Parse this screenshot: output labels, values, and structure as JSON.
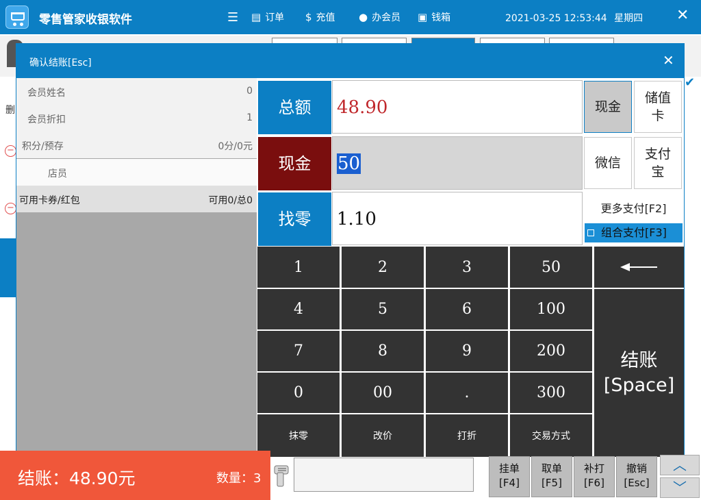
{
  "app": {
    "title": "零售管家收银软件",
    "datetime": "2021-03-25 12:53:44",
    "weekday": "星期四"
  },
  "nav": [
    {
      "label": "订单",
      "icon": "order-icon"
    },
    {
      "label": "充值",
      "icon": "money-bag-icon"
    },
    {
      "label": "办会员",
      "icon": "user-icon"
    },
    {
      "label": "钱箱",
      "icon": "cash-box-icon"
    }
  ],
  "background": {
    "side_label": "删"
  },
  "dialog": {
    "title": "确认结账[Esc]",
    "member_name_label": "会员姓名",
    "member_name_value": "0",
    "member_discount_label": "会员折扣",
    "member_discount_value": "1",
    "points_label": "积分/预存",
    "points_value": "0分/0元",
    "clerk_label": "店员",
    "clerk_value": "",
    "coupon_label": "可用卡券/红包",
    "coupon_value": "可用0/总0"
  },
  "amounts": {
    "total_label": "总额",
    "total_value": "48.90",
    "cash_label": "现金",
    "cash_value": "50",
    "change_label": "找零",
    "change_value": "1.10"
  },
  "payments": {
    "cash": "现金",
    "stored_card": "储值卡",
    "wechat": "微信",
    "alipay": "支付宝",
    "more": "更多支付[F2]",
    "combo": "组合支付[F3]"
  },
  "keypad": {
    "k1": "1",
    "k2": "2",
    "k3": "3",
    "k50": "50",
    "k4": "4",
    "k5": "5",
    "k6": "6",
    "k100": "100",
    "k7": "7",
    "k8": "8",
    "k9": "9",
    "k200": "200",
    "k0": "0",
    "k00": "00",
    "kdot": ".",
    "k300": "300",
    "round_off": "抹零",
    "change_price": "改价",
    "discount": "打折",
    "trade_mode": "交易方式",
    "checkout_line1": "结账",
    "checkout_line2": "[Space]"
  },
  "footer": {
    "checkout_total": "结账：48.90元",
    "quantity": "数量：3",
    "hold_label": "挂单",
    "hold_key": "[F4]",
    "retrieve_label": "取单",
    "retrieve_key": "[F5]",
    "reprint_label": "补打",
    "reprint_key": "[F6]",
    "cancel_label": "撤销",
    "cancel_key": "[Esc]"
  },
  "colors": {
    "brand_blue": "#0c7fc4",
    "total_red": "#c0282c",
    "cash_label_bg": "#7a0e0e",
    "footer_orange": "#f0573a",
    "keypad_key": "#333333"
  }
}
